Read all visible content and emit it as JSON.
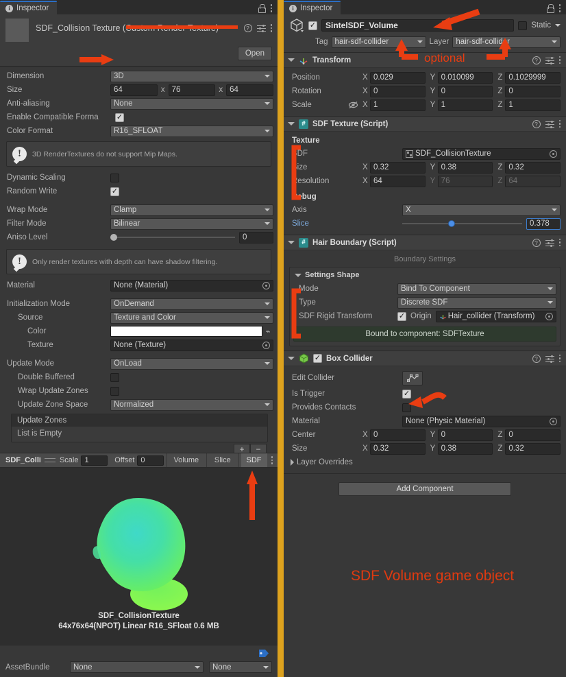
{
  "left_panel": {
    "tab": {
      "label": "Inspector",
      "icon": "info-icon"
    },
    "asset": {
      "title": "SDF_Collision Texture",
      "type_suffix": "(Custom Render Texture)",
      "open_button": "Open"
    },
    "fields": {
      "dimension": {
        "label": "Dimension",
        "value": "3D"
      },
      "size": {
        "label": "Size",
        "x": "64",
        "y": "76",
        "z": "64",
        "sep": "x"
      },
      "anti_aliasing": {
        "label": "Anti-aliasing",
        "value": "None"
      },
      "enable_compatible_format": {
        "label": "Enable Compatible Forma",
        "checked": true
      },
      "color_format": {
        "label": "Color Format",
        "value": "R16_SFLOAT"
      },
      "mip_warning": "3D RenderTextures do not support Mip Maps.",
      "dynamic_scaling": {
        "label": "Dynamic Scaling",
        "checked": false
      },
      "random_write": {
        "label": "Random Write",
        "checked": true
      },
      "wrap_mode": {
        "label": "Wrap Mode",
        "value": "Clamp"
      },
      "filter_mode": {
        "label": "Filter Mode",
        "value": "Bilinear"
      },
      "aniso_level": {
        "label": "Aniso Level",
        "value": "0"
      },
      "shadow_warning": "Only render textures with depth can have shadow filtering.",
      "material": {
        "label": "Material",
        "value": "None (Material)"
      },
      "initialization_mode": {
        "label": "Initialization Mode",
        "value": "OnDemand"
      },
      "source": {
        "label": "Source",
        "value": "Texture and Color"
      },
      "color": {
        "label": "Color",
        "value": "#ffffff"
      },
      "texture": {
        "label": "Texture",
        "value": "None (Texture)"
      },
      "update_mode": {
        "label": "Update Mode",
        "value": "OnLoad"
      },
      "double_buffered": {
        "label": "Double Buffered",
        "checked": false
      },
      "wrap_update_zones": {
        "label": "Wrap Update Zones",
        "checked": false
      },
      "update_zone_space": {
        "label": "Update Zone Space",
        "value": "Normalized"
      },
      "update_zones": {
        "label": "Update Zones",
        "empty_text": "List is Empty",
        "add": "+",
        "remove": "−"
      }
    },
    "preview_toolbar": {
      "name": "SDF_Collisio",
      "scale_label": "Scale",
      "scale_value": "1",
      "offset_label": "Offset",
      "offset_value": "0",
      "modes": [
        "Volume",
        "Slice",
        "SDF"
      ],
      "active_mode": "SDF"
    },
    "preview": {
      "caption_line1": "SDF_CollisionTexture",
      "caption_line2": "64x76x64(NPOT) Linear  R16_SFloat  0.6 MB"
    },
    "asset_bundle": {
      "label": "AssetBundle",
      "value": "None",
      "variant_value": "None"
    }
  },
  "right_panel": {
    "tab": {
      "label": "Inspector",
      "icon": "info-icon"
    },
    "game_object": {
      "enabled": true,
      "name": "SintelSDF_Volume",
      "static_label": "Static",
      "static_checked": false,
      "tag_label": "Tag",
      "tag_value": "hair-sdf-collider",
      "layer_label": "Layer",
      "layer_value": "hair-sdf-collider"
    },
    "transform": {
      "title": "Transform",
      "rows": [
        {
          "label": "Position",
          "x": "0.029",
          "y": "0.010099",
          "z": "0.1029999"
        },
        {
          "label": "Rotation",
          "x": "0",
          "y": "0",
          "z": "0"
        },
        {
          "label": "Scale",
          "x": "1",
          "y": "1",
          "z": "1"
        }
      ]
    },
    "sdf_texture": {
      "title": "SDF Texture (Script)",
      "texture_section": "Texture",
      "sdf_label": "SDF",
      "sdf_value": "SDF_CollisionTexture",
      "size_label": "Size",
      "size": {
        "x": "0.32",
        "y": "0.38",
        "z": "0.32"
      },
      "resolution_label": "Resolution",
      "resolution": {
        "x": "64",
        "y": "76",
        "z": "64"
      },
      "debug_section": "Debug",
      "axis_label": "Axis",
      "axis_value": "X",
      "slice_label": "Slice",
      "slice_value": "0.378"
    },
    "hair_boundary": {
      "title": "Hair Boundary (Script)",
      "subtitle": "Boundary Settings",
      "settings_shape": "Settings Shape",
      "mode_label": "Mode",
      "mode_value": "Bind To Component",
      "type_label": "Type",
      "type_value": "Discrete SDF",
      "rigid_label": "SDF Rigid Transform",
      "rigid_checked": true,
      "origin_label": "Origin",
      "origin_value": "Hair_collider (Transform)",
      "bound_message": "Bound to component: SDFTexture"
    },
    "box_collider": {
      "title": "Box Collider",
      "enabled": true,
      "edit_collider_label": "Edit Collider",
      "is_trigger_label": "Is Trigger",
      "is_trigger_checked": true,
      "provides_contacts_label": "Provides Contacts",
      "provides_contacts_checked": false,
      "material_label": "Material",
      "material_value": "None (Physic Material)",
      "center_label": "Center",
      "center": {
        "x": "0",
        "y": "0",
        "z": "0"
      },
      "size_label": "Size",
      "size": {
        "x": "0.32",
        "y": "0.38",
        "z": "0.32"
      },
      "layer_overrides_label": "Layer Overrides"
    },
    "add_component_label": "Add Component"
  },
  "annotations": {
    "optional_label": "optional",
    "sdf_volume_label": "SDF Volume game object",
    "color": "#e03a10"
  }
}
